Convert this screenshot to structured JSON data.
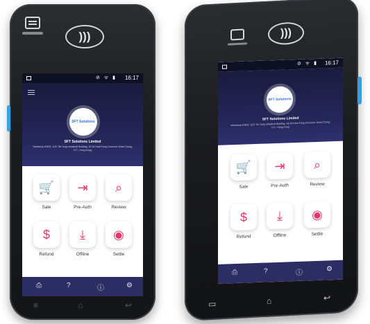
{
  "front_terminal": {
    "status_time": "16:17",
    "status_icons": "⊘ ᯤ ▮",
    "nfc_symbol": ")))",
    "merchant_name": "SFT Solutions Limited",
    "merchant_address": "Workshop 8-B03, 11/F, Tai Yung Industrial Building, 18-24 Kwai Fung Crescent, Kwai Chung, N.T., Hong Kong",
    "logo_text": "SFT Solutions",
    "tiles": [
      {
        "label": "Sale",
        "icon": "cart-icon",
        "glyph": "🛒"
      },
      {
        "label": "Pre-Auth",
        "icon": "login-icon",
        "glyph": "⇥"
      },
      {
        "label": "Review",
        "icon": "search-icon",
        "glyph": "⌕"
      },
      {
        "label": "Refund",
        "icon": "refund-icon",
        "glyph": "$"
      },
      {
        "label": "Offline",
        "icon": "download-icon",
        "glyph": "⤓"
      },
      {
        "label": "Settle",
        "icon": "coins-icon",
        "glyph": "◉"
      }
    ],
    "nav_icons": [
      "printer-icon",
      "help-icon",
      "info-icon",
      "gear-icon"
    ],
    "nav_glyphs": [
      "⎙",
      "?",
      "ⓘ",
      "⚙"
    ],
    "hw_buttons": [
      "≡",
      "⌂",
      "↩"
    ]
  },
  "angled_terminal": {
    "status_time": "16:17",
    "status_icons": "⊘ ᯤ ▮",
    "nfc_symbol": ")))",
    "merchant_name": "SFT Solutions Limited",
    "merchant_address": "Workshop 8-B03, 11/F, Tai Yung Industrial Building, 18-24 Kwai Fung Crescent, Kwai Chung, N.T., Hong Kong",
    "logo_text": "SFT Solutions",
    "tiles": [
      {
        "label": "Sale",
        "icon": "cart-icon",
        "glyph": "🛒"
      },
      {
        "label": "Pre-Auth",
        "icon": "login-icon",
        "glyph": "⇥"
      },
      {
        "label": "Review",
        "icon": "search-icon",
        "glyph": "⌕"
      },
      {
        "label": "Refund",
        "icon": "refund-icon",
        "glyph": "$"
      },
      {
        "label": "Offline",
        "icon": "download-icon",
        "glyph": "⤓"
      },
      {
        "label": "Settle",
        "icon": "coins-icon",
        "glyph": "◉"
      }
    ],
    "nav_icons": [
      "printer-icon",
      "help-icon",
      "info-icon",
      "gear-icon"
    ],
    "nav_glyphs": [
      "⎙",
      "?",
      "ⓘ",
      "⚙"
    ],
    "hw_buttons": [
      "▭",
      "⌂",
      "↩"
    ]
  },
  "colors": {
    "accent_pink": "#e8356c",
    "header_navy": "#25275a",
    "nav_navy": "#2b2d63",
    "side_button_blue": "#3aa0e0"
  }
}
